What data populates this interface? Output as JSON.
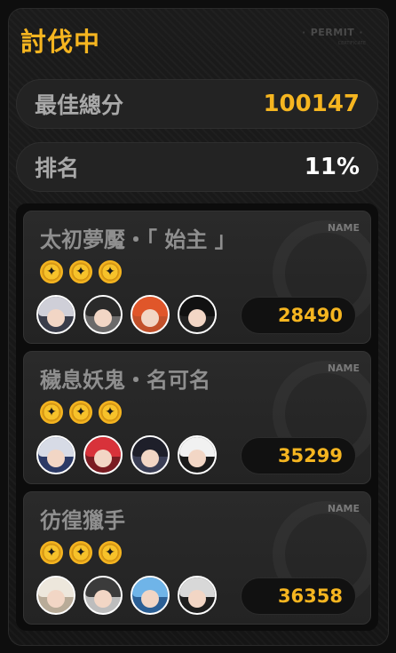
{
  "header": {
    "title": "討伐中",
    "permit": "PERMIT",
    "permit_sub": "CERTIFICATE"
  },
  "stats": {
    "best_total_label": "最佳總分",
    "best_total_value": "100147",
    "rank_label": "排名",
    "rank_value": "11%"
  },
  "colors": {
    "accent": "#f5b520",
    "label": "#a9a9a9"
  },
  "bosses": [
    {
      "name": "太初夢魘・「 始主 」",
      "tag": "NAME",
      "stars": 3,
      "score": "28490",
      "team": [
        {
          "name": "agent-1-avatar",
          "hair": "#cfcfd8",
          "bg": "#3a3d4a"
        },
        {
          "name": "agent-2-avatar",
          "hair": "#2a2a2a",
          "bg": "#6b6a6a"
        },
        {
          "name": "agent-3-avatar",
          "hair": "#e0562a",
          "bg": "#c2502a"
        },
        {
          "name": "bangboo-1-avatar",
          "hair": "#111111",
          "bg": "#222222"
        }
      ]
    },
    {
      "name": "穢息妖鬼・名可名",
      "tag": "NAME",
      "stars": 3,
      "score": "35299",
      "team": [
        {
          "name": "agent-4-avatar",
          "hair": "#d7dbe6",
          "bg": "#2c3a66"
        },
        {
          "name": "agent-5-avatar",
          "hair": "#d8323a",
          "bg": "#7a1c22"
        },
        {
          "name": "agent-6-avatar",
          "hair": "#1e1f2a",
          "bg": "#3a3e55"
        },
        {
          "name": "bangboo-2-avatar",
          "hair": "#f1f1f1",
          "bg": "#1a1a1a"
        }
      ]
    },
    {
      "name": "彷徨獵手",
      "tag": "NAME",
      "stars": 3,
      "score": "36358",
      "team": [
        {
          "name": "agent-7-avatar",
          "hair": "#ede7dc",
          "bg": "#b8ab98"
        },
        {
          "name": "agent-8-avatar",
          "hair": "#3b3b3b",
          "bg": "#bdbdbd"
        },
        {
          "name": "agent-9-avatar",
          "hair": "#6fb4e8",
          "bg": "#2b5f95"
        },
        {
          "name": "bangboo-3-avatar",
          "hair": "#d8d8d8",
          "bg": "#1e1e1e"
        }
      ]
    }
  ]
}
